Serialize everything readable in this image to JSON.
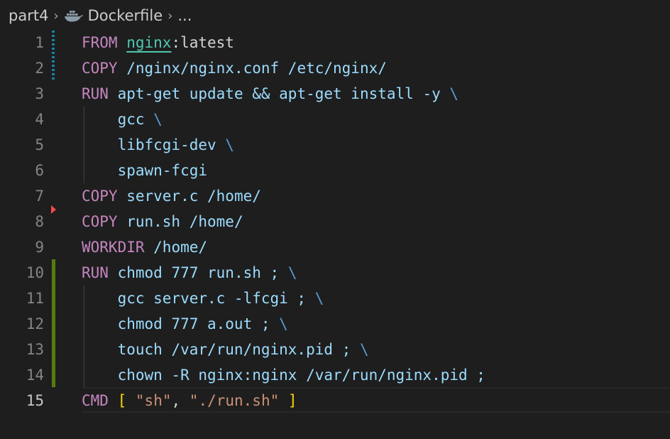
{
  "breadcrumb": {
    "folder": "part4",
    "file": "Dockerfile",
    "more": "...",
    "file_icon": "docker-icon"
  },
  "colors": {
    "background": "#1e1e1e",
    "keyword": "#c586c0",
    "text": "#9cdcfe",
    "string": "#ce9178",
    "bracket": "#ffd700",
    "line_number": "#858585",
    "gutter_modified": "#1b81a8",
    "gutter_added": "#587c0c",
    "gutter_deleted": "#f14c4c"
  },
  "editor": {
    "active_line": 15,
    "lines": [
      {
        "n": "1",
        "kw": "FROM",
        "image": "nginx",
        "rest": ":latest",
        "escape": ""
      },
      {
        "n": "2",
        "kw": "COPY",
        "rest": " /nginx/nginx.conf /etc/nginx/",
        "escape": ""
      },
      {
        "n": "3",
        "kw": "RUN",
        "rest": " apt-get update && apt-get install -y ",
        "escape": "\\"
      },
      {
        "n": "4",
        "kw": "",
        "rest": "    gcc ",
        "escape": "\\"
      },
      {
        "n": "5",
        "kw": "",
        "rest": "    libfcgi-dev ",
        "escape": "\\"
      },
      {
        "n": "6",
        "kw": "",
        "rest": "    spawn-fcgi",
        "escape": ""
      },
      {
        "n": "7",
        "kw": "COPY",
        "rest": " server.c /home/",
        "escape": ""
      },
      {
        "n": "8",
        "kw": "COPY",
        "rest": " run.sh /home/",
        "escape": ""
      },
      {
        "n": "9",
        "kw": "WORKDIR",
        "rest": " /home/",
        "escape": ""
      },
      {
        "n": "10",
        "kw": "RUN",
        "rest": " chmod 777 run.sh ; ",
        "escape": "\\"
      },
      {
        "n": "11",
        "kw": "",
        "rest": "    gcc server.c -lfcgi ; ",
        "escape": "\\"
      },
      {
        "n": "12",
        "kw": "",
        "rest": "    chmod 777 a.out ; ",
        "escape": "\\"
      },
      {
        "n": "13",
        "kw": "",
        "rest": "    touch /var/run/nginx.pid ; ",
        "escape": "\\"
      },
      {
        "n": "14",
        "kw": "",
        "rest": "    chown -R nginx:nginx /var/run/nginx.pid ;",
        "escape": ""
      },
      {
        "n": "15",
        "kw": "CMD",
        "cmd": {
          "open": "[",
          "arg1": "\"sh\"",
          "comma": ",",
          "arg2": "\"./run.sh\"",
          "close": "]"
        }
      }
    ]
  }
}
